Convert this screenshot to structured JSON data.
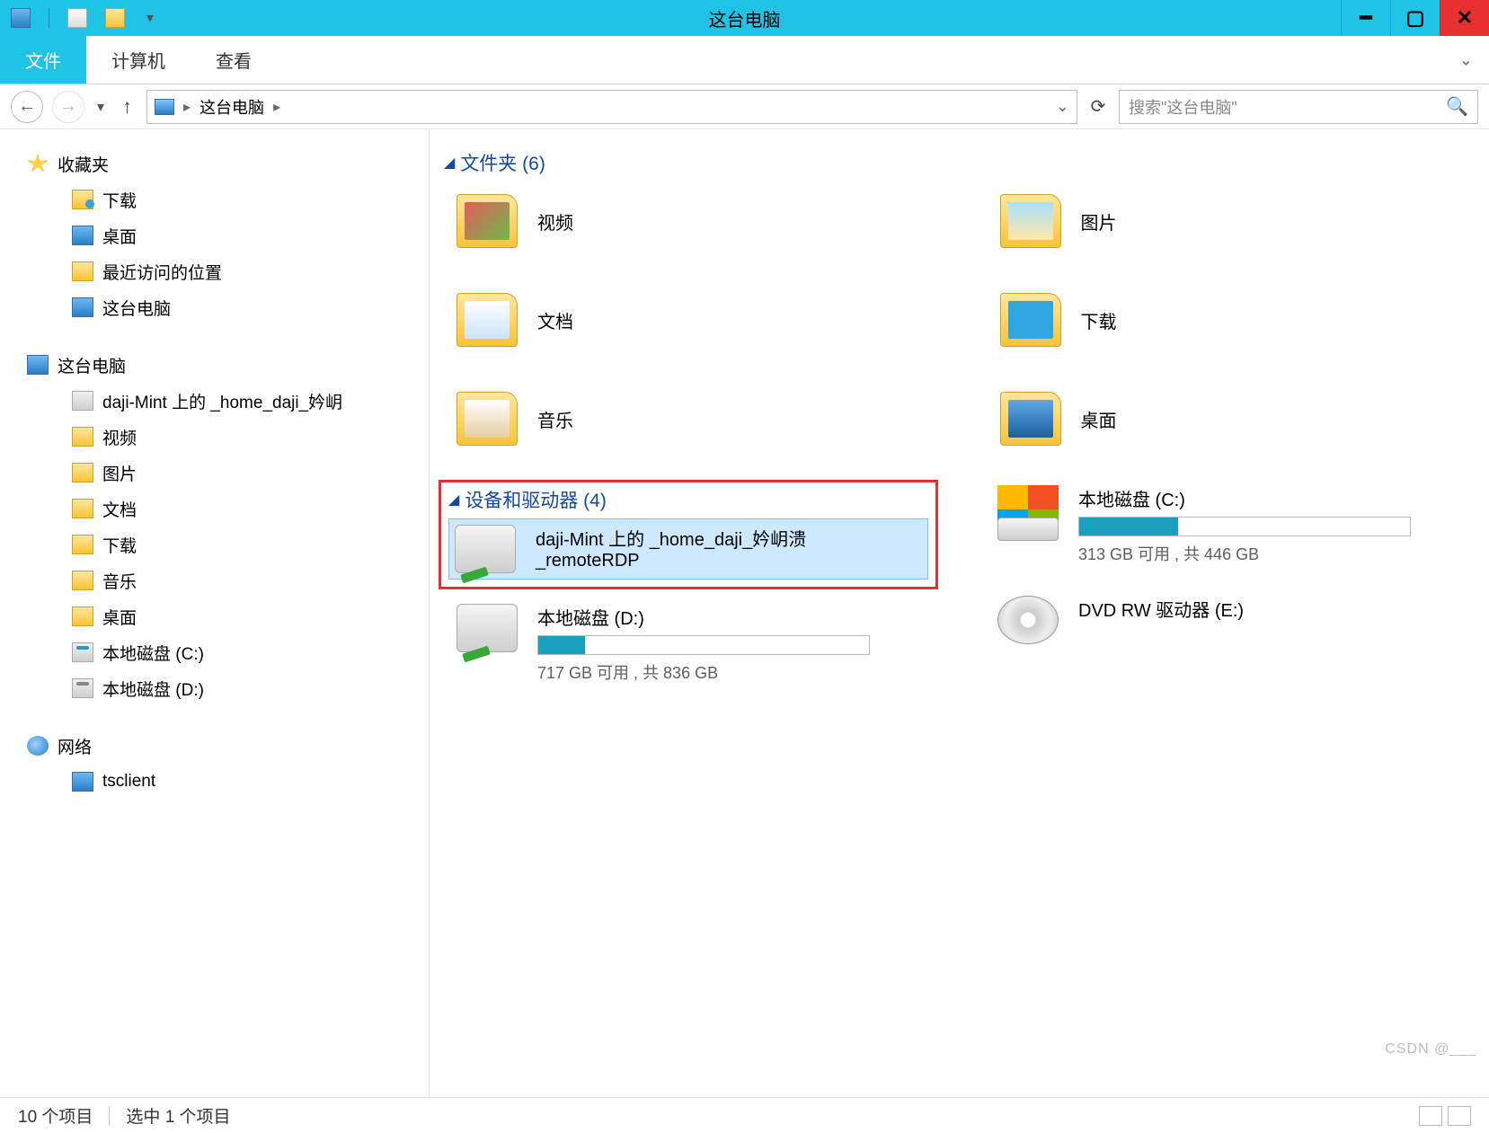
{
  "titlebar": {
    "title": "这台电脑"
  },
  "ribbon": {
    "file": "文件",
    "computer": "计算机",
    "view": "查看"
  },
  "addressbar": {
    "location": "这台电脑",
    "chevron": "▸"
  },
  "search": {
    "placeholder": "搜索\"这台电脑\""
  },
  "sidebar": {
    "favorites": {
      "label": "收藏夹",
      "items": [
        {
          "label": "下载"
        },
        {
          "label": "桌面"
        },
        {
          "label": "最近访问的位置"
        },
        {
          "label": "这台电脑"
        }
      ]
    },
    "thispc": {
      "label": "这台电脑",
      "items": [
        {
          "label": "daji-Mint 上的 _home_daji_妗岄"
        },
        {
          "label": "视频"
        },
        {
          "label": "图片"
        },
        {
          "label": "文档"
        },
        {
          "label": "下载"
        },
        {
          "label": "音乐"
        },
        {
          "label": "桌面"
        },
        {
          "label": "本地磁盘 (C:)"
        },
        {
          "label": "本地磁盘 (D:)"
        }
      ]
    },
    "network": {
      "label": "网络",
      "items": [
        {
          "label": "tsclient"
        }
      ]
    }
  },
  "content": {
    "folders": {
      "header": "文件夹 (6)",
      "items": [
        {
          "label": "视频"
        },
        {
          "label": "图片"
        },
        {
          "label": "文档"
        },
        {
          "label": "下载"
        },
        {
          "label": "音乐"
        },
        {
          "label": "桌面"
        }
      ]
    },
    "devices": {
      "header": "设备和驱动器 (4)",
      "remote": {
        "name": "daji-Mint 上的 _home_daji_妗岄溃_remoteRDP"
      },
      "c": {
        "name": "本地磁盘 (C:)",
        "stats": "313 GB 可用 , 共 446 GB",
        "fill_pct": 30
      },
      "d": {
        "name": "本地磁盘 (D:)",
        "stats": "717 GB 可用 , 共 836 GB",
        "fill_pct": 14
      },
      "dvd": {
        "name": "DVD RW 驱动器 (E:)"
      }
    }
  },
  "statusbar": {
    "count": "10 个项目",
    "selected": "选中 1 个项目"
  },
  "watermark": "CSDN @___"
}
